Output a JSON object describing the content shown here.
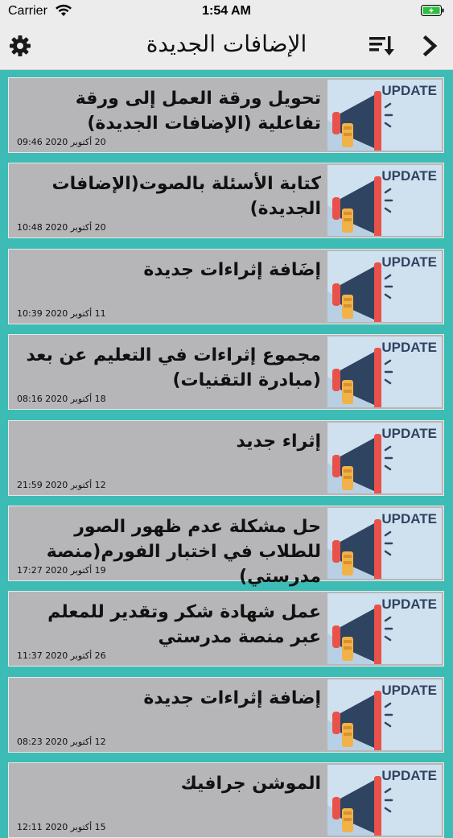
{
  "status_bar": {
    "carrier": "Carrier",
    "time": "1:54 AM"
  },
  "nav": {
    "title": "الإضافات الجديدة"
  },
  "thumb_label": "UPDATE",
  "items": [
    {
      "title": "تحويل ورقة العمل إلى ورقة تفاعلية (الإضافات الجديدة)",
      "date": "20 أكتوبر 2020 09:46"
    },
    {
      "title": "كتابة الأسئلة بالصوت(الإضافات الجديدة)",
      "date": "20 أكتوبر 2020 10:48"
    },
    {
      "title": "إضَافة إثراءات جديدة",
      "date": "11 أكتوبر 2020 10:39"
    },
    {
      "title": "مجموع إثراءات في التعليم عن بعد (مبادرة التقنيات)",
      "date": "18 أكتوبر 2020 08:16"
    },
    {
      "title": "إثراء جديد",
      "date": "12 أكتوبر 2020 21:59"
    },
    {
      "title": "حل مشكلة عدم ظهور الصور للطلاب في اختبار الفورم(منصة مدرستي)",
      "date": "19 أكتوبر 2020 17:27"
    },
    {
      "title": "عمل شهادة شكر وتقدير للمعلم عبر منصة مدرستي",
      "date": "26 أكتوبر 2020 11:37"
    },
    {
      "title": "إضافة إثراءات جديدة",
      "date": "12 أكتوبر 2020 08:23"
    },
    {
      "title": "الموشن جرافيك",
      "date": "15 أكتوبر 2020 12:11"
    }
  ],
  "colors": {
    "background": "#3cbcb4",
    "card": "#b6b6b9",
    "bar": "#ececec",
    "accent_red": "#e8524a",
    "navy": "#2f4461"
  }
}
